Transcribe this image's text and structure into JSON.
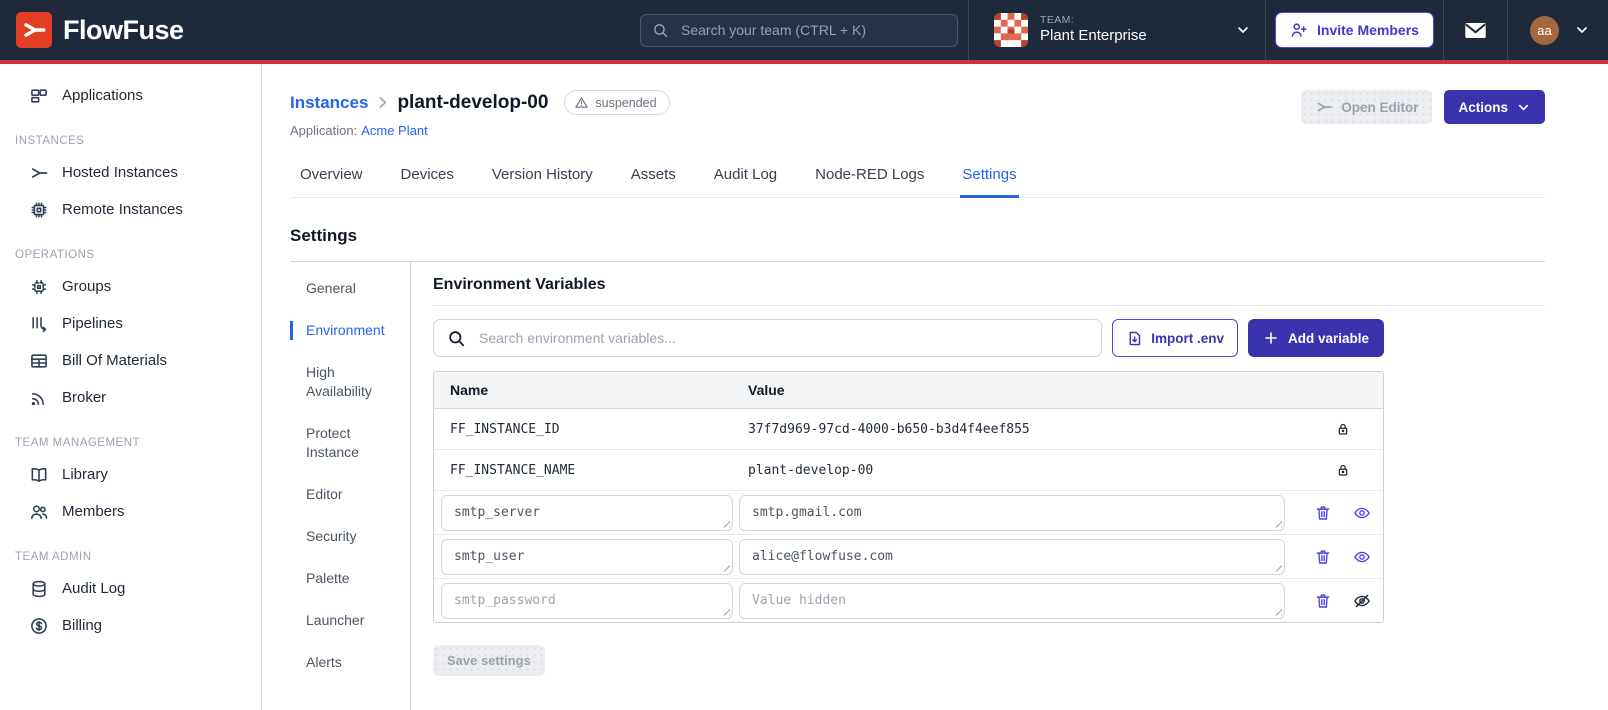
{
  "colors": {
    "header_bg": "#1E2939",
    "header_rule_red": "#D2313B",
    "logo_red": "#E23E26",
    "primary_indigo": "#3B33AE",
    "accent_indigo": "#4F46E5",
    "link_blue": "#2563EB",
    "text_dark": "#111827",
    "muted_gray": "#6B7280",
    "avatar_brown": "#A5673F",
    "identicon_coral": "#DF6A50"
  },
  "header": {
    "brand": "FlowFuse",
    "search_placeholder": "Search your team (CTRL + K)",
    "team_label": "TEAM:",
    "team_name": "Plant Enterprise",
    "invite_label": "Invite Members",
    "avatar_initials": "aa"
  },
  "sidebar": {
    "items": [
      {
        "type": "item",
        "icon": "applications-icon",
        "label": "Applications"
      },
      {
        "type": "section",
        "label": "INSTANCES"
      },
      {
        "type": "item",
        "icon": "hosted-instances-icon",
        "label": "Hosted Instances"
      },
      {
        "type": "item",
        "icon": "remote-instances-icon",
        "label": "Remote Instances"
      },
      {
        "type": "section",
        "label": "OPERATIONS"
      },
      {
        "type": "item",
        "icon": "groups-icon",
        "label": "Groups"
      },
      {
        "type": "item",
        "icon": "pipelines-icon",
        "label": "Pipelines"
      },
      {
        "type": "item",
        "icon": "bill-of-materials-icon",
        "label": "Bill Of Materials"
      },
      {
        "type": "item",
        "icon": "broker-icon",
        "label": "Broker"
      },
      {
        "type": "section",
        "label": "TEAM MANAGEMENT"
      },
      {
        "type": "item",
        "icon": "library-icon",
        "label": "Library"
      },
      {
        "type": "item",
        "icon": "members-icon",
        "label": "Members"
      },
      {
        "type": "section",
        "label": "TEAM ADMIN"
      },
      {
        "type": "item",
        "icon": "audit-log-icon",
        "label": "Audit Log"
      },
      {
        "type": "item",
        "icon": "billing-icon",
        "label": "Billing"
      }
    ]
  },
  "page": {
    "breadcrumb_root": "Instances",
    "instance_name": "plant-develop-00",
    "status_badge": "suspended",
    "application_label": "Application:",
    "application_name": "Acme Plant",
    "open_editor_label": "Open Editor",
    "actions_label": "Actions"
  },
  "tabs": [
    {
      "label": "Overview",
      "active": false
    },
    {
      "label": "Devices",
      "active": false
    },
    {
      "label": "Version History",
      "active": false
    },
    {
      "label": "Assets",
      "active": false
    },
    {
      "label": "Audit Log",
      "active": false
    },
    {
      "label": "Node-RED Logs",
      "active": false
    },
    {
      "label": "Settings",
      "active": true
    }
  ],
  "settings": {
    "title": "Settings",
    "nav": [
      {
        "label": "General",
        "active": false
      },
      {
        "label": "Environment",
        "active": true
      },
      {
        "label": "High Availability",
        "active": false
      },
      {
        "label": "Protect Instance",
        "active": false
      },
      {
        "label": "Editor",
        "active": false
      },
      {
        "label": "Security",
        "active": false
      },
      {
        "label": "Palette",
        "active": false
      },
      {
        "label": "Launcher",
        "active": false
      },
      {
        "label": "Alerts",
        "active": false
      }
    ]
  },
  "env": {
    "heading": "Environment Variables",
    "search_placeholder": "Search environment variables...",
    "import_label": "Import .env",
    "add_label": "Add variable",
    "columns": [
      "Name",
      "Value"
    ],
    "rows": [
      {
        "name": "FF_INSTANCE_ID",
        "value": "37f7d969-97cd-4000-b650-b3d4f4eef855",
        "locked": true
      },
      {
        "name": "FF_INSTANCE_NAME",
        "value": "plant-develop-00",
        "locked": true
      },
      {
        "name": "smtp_server",
        "value": "smtp.gmail.com",
        "locked": false,
        "value_visible": true,
        "dimmed": false
      },
      {
        "name": "smtp_user",
        "value": "alice@flowfuse.com",
        "locked": false,
        "value_visible": true,
        "dimmed": false
      },
      {
        "name": "smtp_password",
        "value": "",
        "value_placeholder": "Value hidden",
        "locked": false,
        "value_visible": false,
        "dimmed": true
      }
    ],
    "save_label": "Save settings"
  }
}
